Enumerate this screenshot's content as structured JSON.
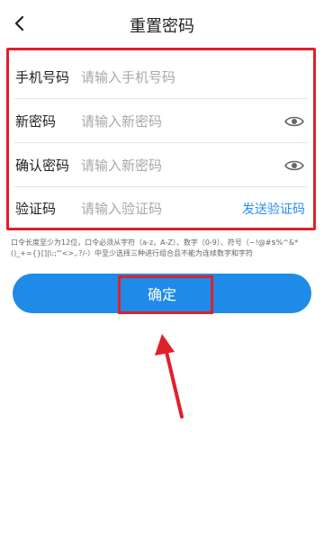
{
  "header": {
    "title": "重置密码"
  },
  "form": {
    "phone": {
      "label": "手机号码",
      "placeholder": "请输入手机号码"
    },
    "new_password": {
      "label": "新密码",
      "placeholder": "请输入新密码"
    },
    "confirm_password": {
      "label": "确认密码",
      "placeholder": "请输入新密码"
    },
    "code": {
      "label": "验证码",
      "placeholder": "请输入验证码",
      "send_label": "发送验证码"
    }
  },
  "hint": "口令长度至少为12位，口令必须从字符（a-z，A-Z）、数字（0-9）、符号（~!@#$%^&*()_+={}[]|\\:;\"'<>,.?/-）中至少选择三种进行组合且不能为连续数字和字符",
  "confirm": {
    "label": "确定"
  },
  "colors": {
    "accent": "#1f8be8",
    "link": "#2a8ef0",
    "highlight": "#e0202a"
  }
}
